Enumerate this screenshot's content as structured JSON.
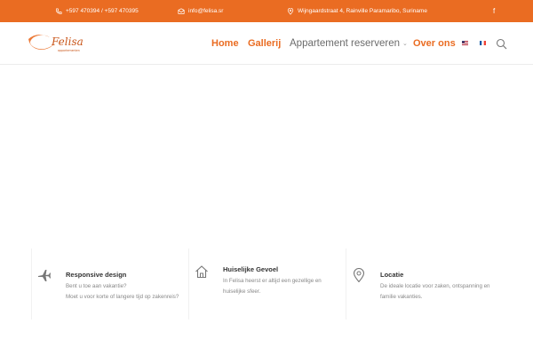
{
  "topbar": {
    "phone": "+597 470394 / +597 470395",
    "email": "info@felisa.sr",
    "address": "Wijngaardstraat 4, Rainville Paramaribo, Suriname",
    "facebook_glyph": "f"
  },
  "brand": {
    "logo_text": "Felisa",
    "logo_sub": "appartementen"
  },
  "nav": {
    "home": "Home",
    "gallerij": "Gallerij",
    "appartement": "Appartement reserveren",
    "over_ons": "Over ons"
  },
  "features": [
    {
      "title": "Responsive design",
      "lines": [
        "Bent u toe aan vakantie?",
        "Moet u voor korte of langere tijd op zakenreis?"
      ]
    },
    {
      "title": "Huiselijke Gevoel",
      "lines": [
        "In Felisa heerst er altijd een gezellige en",
        "huiselijke sfeer."
      ]
    },
    {
      "title": "Locatie",
      "lines": [
        "De ideale locatie voor zaken, ontspanning en",
        "familie vakanties."
      ]
    }
  ],
  "colors": {
    "accent": "#ea6c22",
    "muted_text": "#888888"
  },
  "icons": [
    "phone-icon",
    "mail-icon",
    "location-pin-icon",
    "facebook-icon",
    "search-icon",
    "airplane-icon",
    "home-icon",
    "map-pin-icon"
  ]
}
